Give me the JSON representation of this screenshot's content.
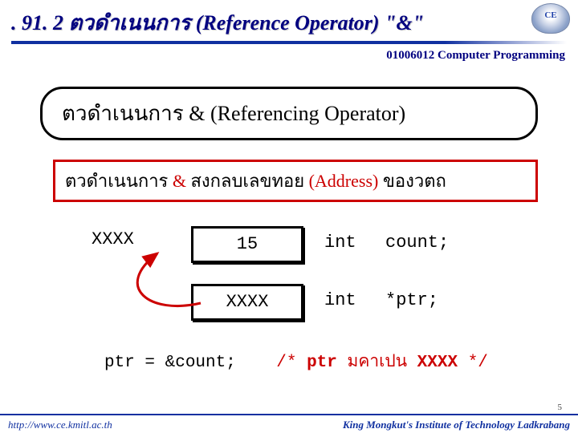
{
  "header": {
    "title": ". 91. 2 ตวดำเนนการ (Reference Operator) \"&\"",
    "course": "01006012 Computer Programming"
  },
  "topic": {
    "part1": "ตวดำเนนการ ",
    "amp": " & ",
    "part2": "(Referencing Operator)"
  },
  "desc": {
    "p1": "ตวดำเนนการ ",
    "amp": "&",
    "p2": " สงกลบเลขทอย ",
    "addr": "(Address)",
    "p3": " ของวตถ"
  },
  "diagram": {
    "addr_label": "XXXX",
    "cell1": "15",
    "type1": "int",
    "decl1": "count;",
    "cell2": "XXXX",
    "type2": "int",
    "decl2": "*ptr;"
  },
  "code": {
    "stmt": "ptr = &count;",
    "comment_open": "/*",
    "comment_ptr": "ptr",
    "comment_mid": "มคาเปน",
    "comment_val": "XXXX",
    "comment_close": "*/"
  },
  "footer": {
    "page": "5",
    "url": "http://www.ce.kmitl.ac.th",
    "org": "King Mongkut's Institute of Technology Ladkrabang"
  }
}
